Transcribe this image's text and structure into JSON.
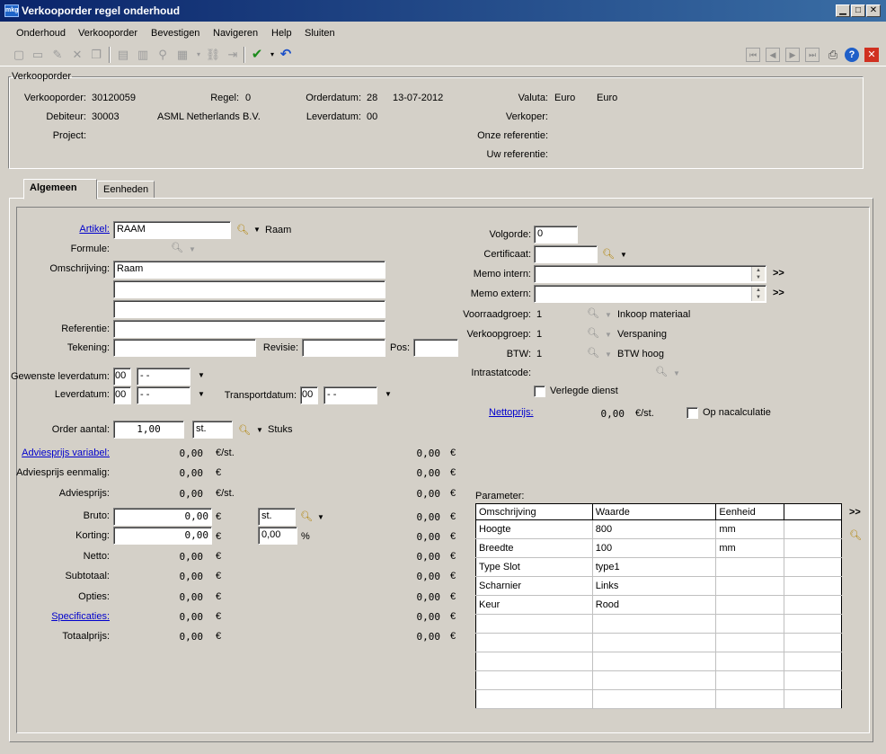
{
  "window": {
    "title": "Verkooporder regel onderhoud",
    "app_icon_text": "mkg"
  },
  "menu": [
    "Onderhoud",
    "Verkooporder",
    "Bevestigen",
    "Navigeren",
    "Help",
    "Sluiten"
  ],
  "header": {
    "group_title": "Verkooporder",
    "verkooporder_label": "Verkooporder:",
    "verkooporder": "30120059",
    "regel_label": "Regel:",
    "regel": "0",
    "orderdatum_label": "Orderdatum:",
    "orderdatum_code": "28",
    "orderdatum": "13-07-2012",
    "valuta_label": "Valuta:",
    "valuta_code": "Euro",
    "valuta_name": "Euro",
    "debiteur_label": "Debiteur:",
    "debiteur": "30003",
    "debiteur_name": "ASML Netherlands B.V.",
    "leverdatum_label": "Leverdatum:",
    "leverdatum_code": "00",
    "verkoper_label": "Verkoper:",
    "project_label": "Project:",
    "onze_ref_label": "Onze referentie:",
    "uw_ref_label": "Uw referentie:"
  },
  "tabs": [
    "Algemeen",
    "Eenheden"
  ],
  "form": {
    "artikel_label": "Artikel:",
    "artikel": "RAAM",
    "artikel_desc": "Raam",
    "formule_label": "Formule:",
    "omschrijving_label": "Omschrijving:",
    "omschrijving": [
      "Raam",
      "",
      ""
    ],
    "referentie_label": "Referentie:",
    "referentie": "",
    "tekening_label": "Tekening:",
    "tekening": "",
    "revisie_label": "Revisie:",
    "revisie": "",
    "pos_label": "Pos:",
    "pos": "",
    "gewenste_leverdatum_label": "Gewenste leverdatum:",
    "gewenste_leverdatum_code": "00",
    "gewenste_leverdatum": "- -",
    "leverdatum_label": "Leverdatum:",
    "leverdatum_code": "00",
    "leverdatum": "- -",
    "transportdatum_label": "Transportdatum:",
    "transportdatum_code": "00",
    "transportdatum": "- -",
    "order_aantal_label": "Order aantal:",
    "order_aantal": "1,00",
    "eenheid": "st.",
    "eenheid_desc": "Stuks",
    "volgorde_label": "Volgorde:",
    "volgorde": "0",
    "certificaat_label": "Certificaat:",
    "certificaat": "",
    "memo_intern_label": "Memo intern:",
    "memo_extern_label": "Memo extern:",
    "more": ">>",
    "voorraadgroep_label": "Voorraadgroep:",
    "voorraadgroep": "1",
    "voorraadgroep_desc": "Inkoop materiaal",
    "verkoopgroep_label": "Verkoopgroep:",
    "verkoopgroep": "1",
    "verkoopgroep_desc": "Verspaning",
    "btw_label": "BTW:",
    "btw": "1",
    "btw_desc": "BTW hoog",
    "intrastatcode_label": "Intrastatcode:",
    "verlegde_dienst_label": "Verlegde dienst",
    "nettoprijs_label": "Nettoprijs:",
    "nettoprijs": "0,00",
    "nettoprijs_unit": "€/st.",
    "op_nacalculatie_label": "Op nacalculatie"
  },
  "pricing": {
    "rows": [
      {
        "label": "Adviesprijs variabel:",
        "link": true,
        "value": "0,00",
        "unit": "€/st.",
        "total": "0,00",
        "cur": "€"
      },
      {
        "label": "Adviesprijs eenmalig:",
        "link": false,
        "value": "0,00",
        "unit": "€",
        "total": "0,00",
        "cur": "€"
      },
      {
        "label": "Adviesprijs:",
        "link": false,
        "value": "0,00",
        "unit": "€/st.",
        "total": "0,00",
        "cur": "€"
      }
    ],
    "bruto_label": "Bruto:",
    "bruto": "0,00",
    "bruto_unit": "€",
    "bruto_eenheid": "st.",
    "bruto_total": "0,00",
    "korting_label": "Korting:",
    "korting": "0,00",
    "korting_unit": "€",
    "korting_pct": "0,00",
    "pct": "%",
    "korting_total": "0,00",
    "lower_rows": [
      {
        "label": "Netto:",
        "link": false,
        "value": "0,00",
        "unit": "€",
        "total": "0,00",
        "cur": "€"
      },
      {
        "label": "Subtotaal:",
        "link": false,
        "value": "0,00",
        "unit": "€",
        "total": "0,00",
        "cur": "€"
      },
      {
        "label": "Opties:",
        "link": false,
        "value": "0,00",
        "unit": "€",
        "total": "0,00",
        "cur": "€"
      },
      {
        "label": "Specificaties:",
        "link": true,
        "value": "0,00",
        "unit": "€",
        "total": "0,00",
        "cur": "€"
      },
      {
        "label": "Totaalprijs:",
        "link": false,
        "value": "0,00",
        "unit": "€",
        "total": "0,00",
        "cur": "€"
      }
    ],
    "cur": "€"
  },
  "parameters": {
    "label": "Parameter:",
    "columns": [
      "Omschrijving",
      "Waarde",
      "Eenheid",
      ""
    ],
    "rows": [
      [
        "Hoogte",
        "800",
        "mm",
        ""
      ],
      [
        "Breedte",
        "100",
        "mm",
        ""
      ],
      [
        "Type Slot",
        "type1",
        "",
        ""
      ],
      [
        "Scharnier",
        "Links",
        "",
        ""
      ],
      [
        "Keur",
        "Rood",
        "",
        ""
      ],
      [
        "",
        "",
        "",
        ""
      ],
      [
        "",
        "",
        "",
        ""
      ],
      [
        "",
        "",
        "",
        ""
      ],
      [
        "",
        "",
        "",
        ""
      ],
      [
        "",
        "",
        "",
        ""
      ]
    ]
  }
}
